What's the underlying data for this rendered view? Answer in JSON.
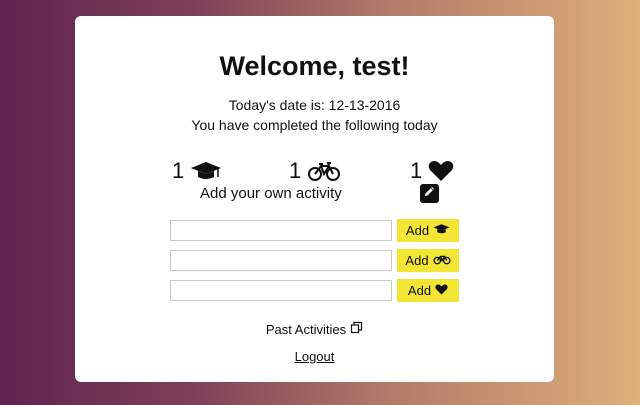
{
  "welcome_title": "Welcome, test!",
  "date_line": "Today's date is: 12-13-2016",
  "completed_line": "You have completed the following today",
  "counters": {
    "study": "1",
    "bike": "1",
    "heart": "1"
  },
  "custom_activity_label": "Add your own activity",
  "forms": {
    "study": {
      "value": "",
      "button_label": "Add"
    },
    "bike": {
      "value": "",
      "button_label": "Add"
    },
    "heart": {
      "value": "",
      "button_label": "Add"
    }
  },
  "past_activities_link": "Past Activities",
  "logout_link": "Logout",
  "colors": {
    "accent_button": "#f2e533",
    "gradient_start": "#5f2350",
    "gradient_end": "#deb07a"
  },
  "icons": [
    "graduation-cap-icon",
    "bicycle-icon",
    "heart-icon",
    "pencil-icon",
    "copy-icon"
  ]
}
